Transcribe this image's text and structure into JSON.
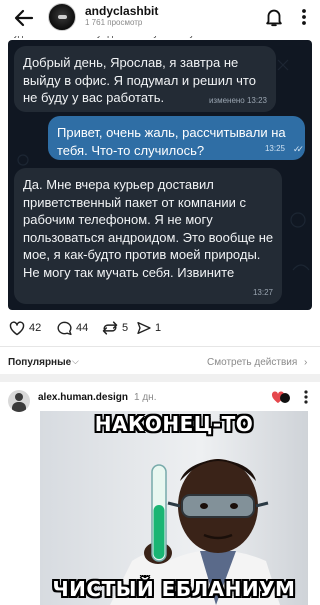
{
  "header": {
    "channel_name": "andyclashbit",
    "views": "1 761 просмотр",
    "back_icon": "arrow-left-icon",
    "bell_icon": "bell-icon",
    "menu_icon": "more-vertical-icon"
  },
  "post_cut_line": "Будьте что как-то обсуждали или ну это какую...",
  "chat": {
    "messages": [
      {
        "side": "incoming",
        "text": "Добрый день, Ярослав, я завтра не выйду в офис. Я подумал и решил что не буду у вас работать.",
        "meta": "изменено 13:23"
      },
      {
        "side": "outgoing",
        "text": "Привет, очень жаль, рассчитывали на тебя. Что-то случилось?",
        "meta": "13:25",
        "status": "✓✓"
      },
      {
        "side": "incoming",
        "text": "Да. Мне вчера курьер доставил приветственный пакет от компании с рабочим телефоном. Я не могу пользоваться андроидом. Это вообще не мое, я как-будто против моей природы. Не могу так мучать себя. Извините",
        "meta": "13:27"
      }
    ],
    "colors": {
      "background": "#101722",
      "incoming": "#232b35",
      "outgoing": "#2f6ea5"
    }
  },
  "reactions": {
    "likes": "42",
    "comments": "44",
    "reposts": "5",
    "views": "1"
  },
  "comments_header": {
    "sort_label": "Популярные",
    "actions_label": "Смотреть действия"
  },
  "comment": {
    "author": "alex.human.design",
    "time": "1 дн.",
    "meme_top": "НАКОНЕЦ-ТО",
    "meme_bottom": "ЧИСТЫЙ ЕБЛАНИУМ"
  }
}
